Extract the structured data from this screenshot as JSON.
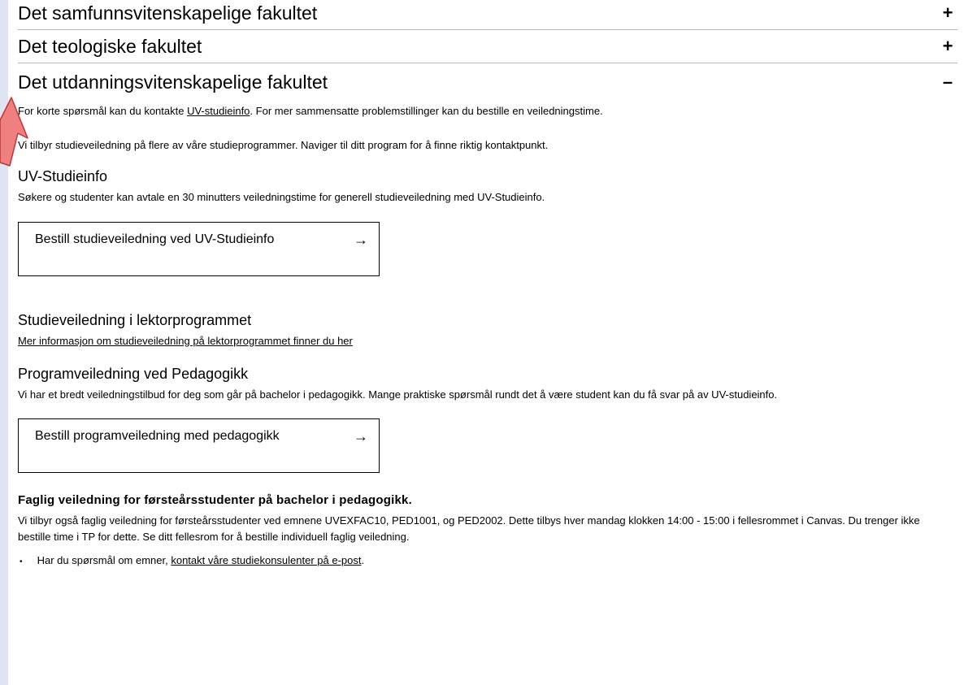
{
  "accordion": [
    {
      "title": "Det samfunnsvitenskapelige fakultet",
      "sign": "+"
    },
    {
      "title": "Det teologiske fakultet",
      "sign": "+"
    },
    {
      "title": "Det utdanningsvitenskapelige fakultet",
      "sign": "–"
    }
  ],
  "open_section": {
    "intro": {
      "before": "For korte spørsmål kan du kontakte ",
      "link": "UV-studieinfo",
      "after": ". For mer sammensatte problemstillinger kan du bestille en veiledningstime."
    },
    "intro2": "Vi tilbyr studieveiledning på flere av våre studieprogrammer. Naviger til ditt program for å finne riktig kontaktpunkt.",
    "uv": {
      "heading": "UV-Studieinfo",
      "text": "Søkere og studenter kan avtale en 30 minutters veiledningstime for generell studieveiledning med UV-Studieinfo.",
      "button": "Bestill studieveiledning ved UV-Studieinfo",
      "arrow": "→"
    },
    "lektor": {
      "heading": "Studieveiledning i lektorprogrammet",
      "link": "Mer informasjon om studieveiledning på lektorprogrammet finner du her"
    },
    "ped": {
      "heading": "Programveiledning ved Pedagogikk",
      "text": "Vi har et bredt veiledningstilbud for deg som går på bachelor i pedagogikk. Mange praktiske spørsmål rundt det å være student kan du få svar på av UV-studieinfo.",
      "button": "Bestill programveiledning med pedagogikk",
      "arrow": "→"
    },
    "faglig": {
      "heading": "Faglig veiledning for førsteårsstudenter på bachelor i pedagogikk.",
      "text": "Vi tilbyr også faglig veiledning for førsteårsstudenter ved emnene UVEXFAC10, PED1001, og PED2002. Dette tilbys hver mandag klokken 14:00 - 15:00 i fellesrommet i Canvas. Du trenger ikke bestille time i TP for dette. Se ditt fellesrom for å bestille individuell faglig veiledning.",
      "bullet_before": "Har du spørsmål om emner, ",
      "bullet_link": "kontakt våre studiekonsulenter på e-post",
      "bullet_after": "."
    }
  },
  "colors": {
    "pointer_fill": "#f07f7f",
    "pointer_stroke": "#c03434",
    "sidebar": "#dfe4f3"
  },
  "icons": {
    "pointer": "mouse-pointer-icon",
    "arrow": "arrow-right-icon"
  }
}
